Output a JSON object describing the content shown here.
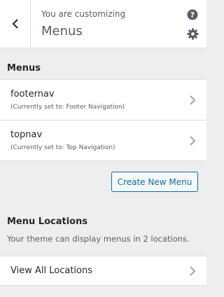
{
  "header": {
    "customizing_label": "You are customizing",
    "panel_title": "Menus"
  },
  "menus_section": {
    "title": "Menus",
    "items": [
      {
        "name": "footernav",
        "assignment": "(Currently set to: Footer Navigation)"
      },
      {
        "name": "topnav",
        "assignment": "(Currently set to: Top Navigation)"
      }
    ],
    "create_button_label": "Create New Menu"
  },
  "locations_section": {
    "title": "Menu Locations",
    "description": "Your theme can display menus in 2 locations.",
    "view_all_label": "View All Locations"
  },
  "colors": {
    "accent": "#0073aa",
    "background": "#eeeeee",
    "panel": "#ffffff",
    "text": "#23282d",
    "muted_text": "#555d66"
  }
}
